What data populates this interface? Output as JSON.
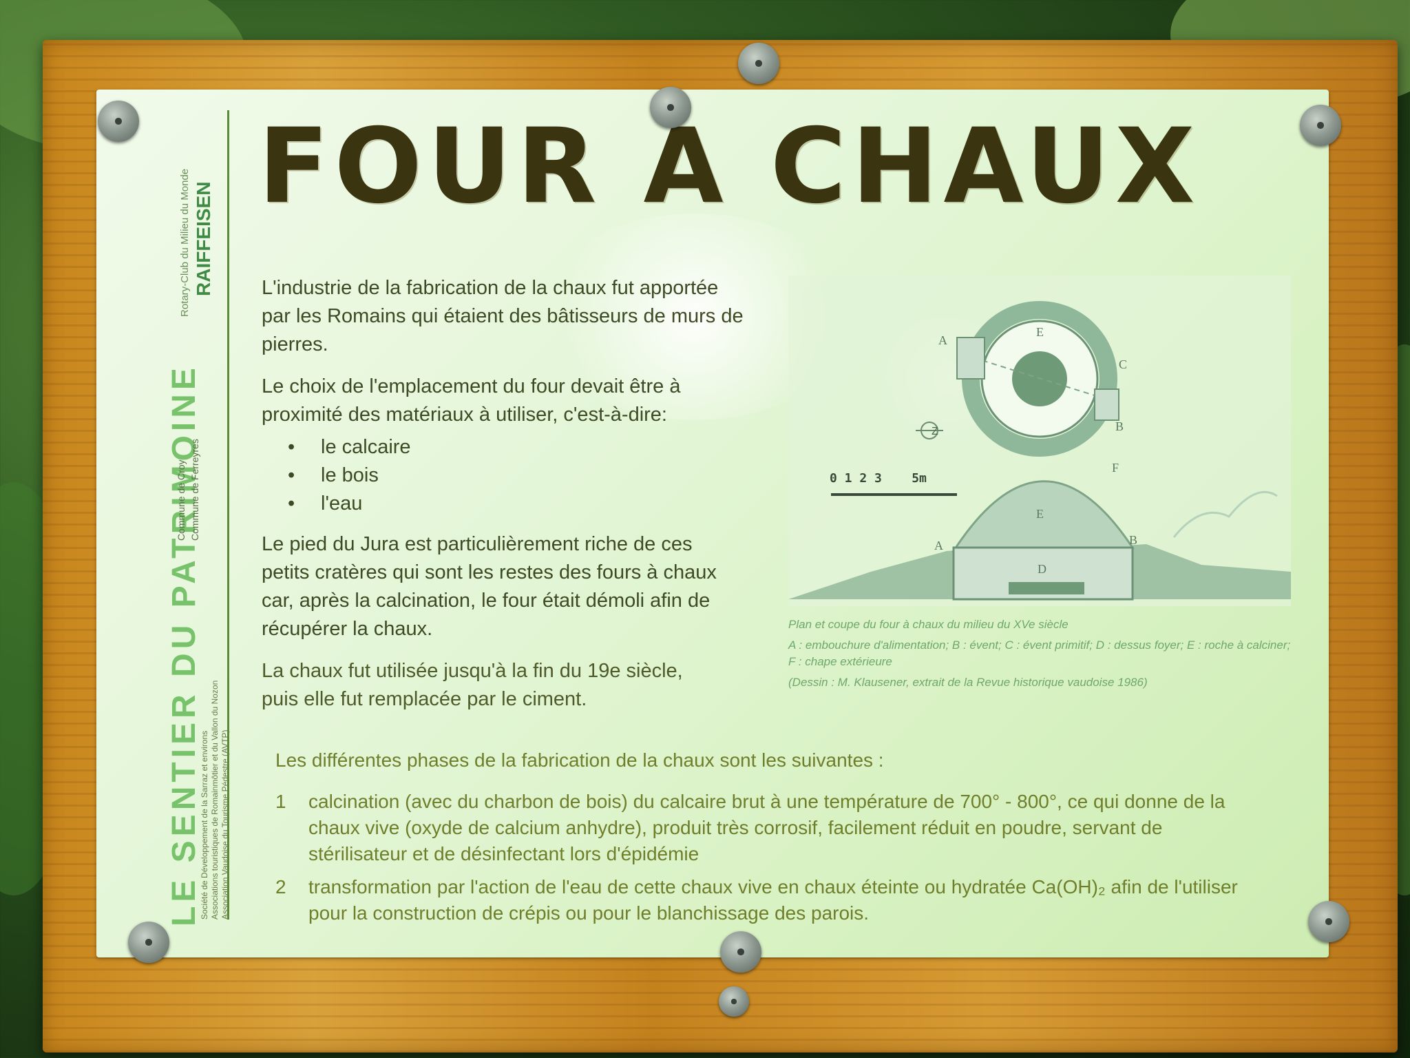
{
  "sign": {
    "title": "FOUR A CHAUX",
    "sidebar": {
      "trail_name": "LE SENTIER DU PATRIMOINE",
      "sponsor_1": "Rotary-Club du Milieu du Monde",
      "sponsor_2": "RAIFFEISEN",
      "communes_1": "Commune de Croy",
      "communes_2": "Commune de Ferreyres",
      "partners_1": "Société de Développement de la Sarraz et environs",
      "partners_2": "Associations touristiques de Romainmôtier et du Vallon du Nozon",
      "partners_3": "Association Vaudoise du Tourisme Pédestre (AVTP)"
    },
    "intro_paragraph": "L'industrie de la fabrication de la chaux fut apportée par les Romains qui étaient des bâtisseurs de murs de pierres.",
    "choice_paragraph": "Le choix de l'emplacement du four devait être à proximité des matériaux à utiliser, c'est-à-dire:",
    "materials": [
      "le calcaire",
      "le bois",
      "l'eau"
    ],
    "jura_paragraph": "Le pied du Jura est particulièrement riche de ces petits cratères qui sont les restes des fours à chaux car, après la calcination, le four était démoli afin de récupérer la chaux.",
    "cement_paragraph": "La chaux fut utilisée jusqu'à la fin du 19e siècle, puis elle fut remplacée par le ciment.",
    "phases_intro": "Les différentes phases de la fabrication de la chaux sont les suivantes :",
    "phases": [
      {
        "number": "1",
        "text": "calcination (avec du charbon de bois) du calcaire brut à une température de 700° - 800°, ce qui donne de la chaux vive (oxyde de calcium anhydre), produit très corrosif, facilement réduit en poudre, servant de stérilisateur et de désinfectant lors d'épidémie"
      },
      {
        "number": "2",
        "text": "transformation par l'action de l'eau de cette chaux vive en chaux éteinte ou hydratée Ca(OH)₂ afin de l'utiliser pour la construction de crépis ou pour le blanchissage des parois."
      }
    ],
    "diagram": {
      "labels": {
        "a": "A",
        "b": "B",
        "c": "C",
        "d": "D",
        "e": "E",
        "f": "F"
      },
      "scale_label": "0 1 2 3    5m",
      "north_label": "Z"
    },
    "caption": {
      "line_1": "Plan et coupe du four à chaux du milieu du XVe siècle",
      "line_2": "A : embouchure d'alimentation; B : évent; C : évent primitif; D : dessus foyer; E : roche à calciner; F : chape extérieure",
      "line_3": "(Dessin : M. Klausener, extrait de la Revue historique vaudoise 1986)"
    }
  }
}
